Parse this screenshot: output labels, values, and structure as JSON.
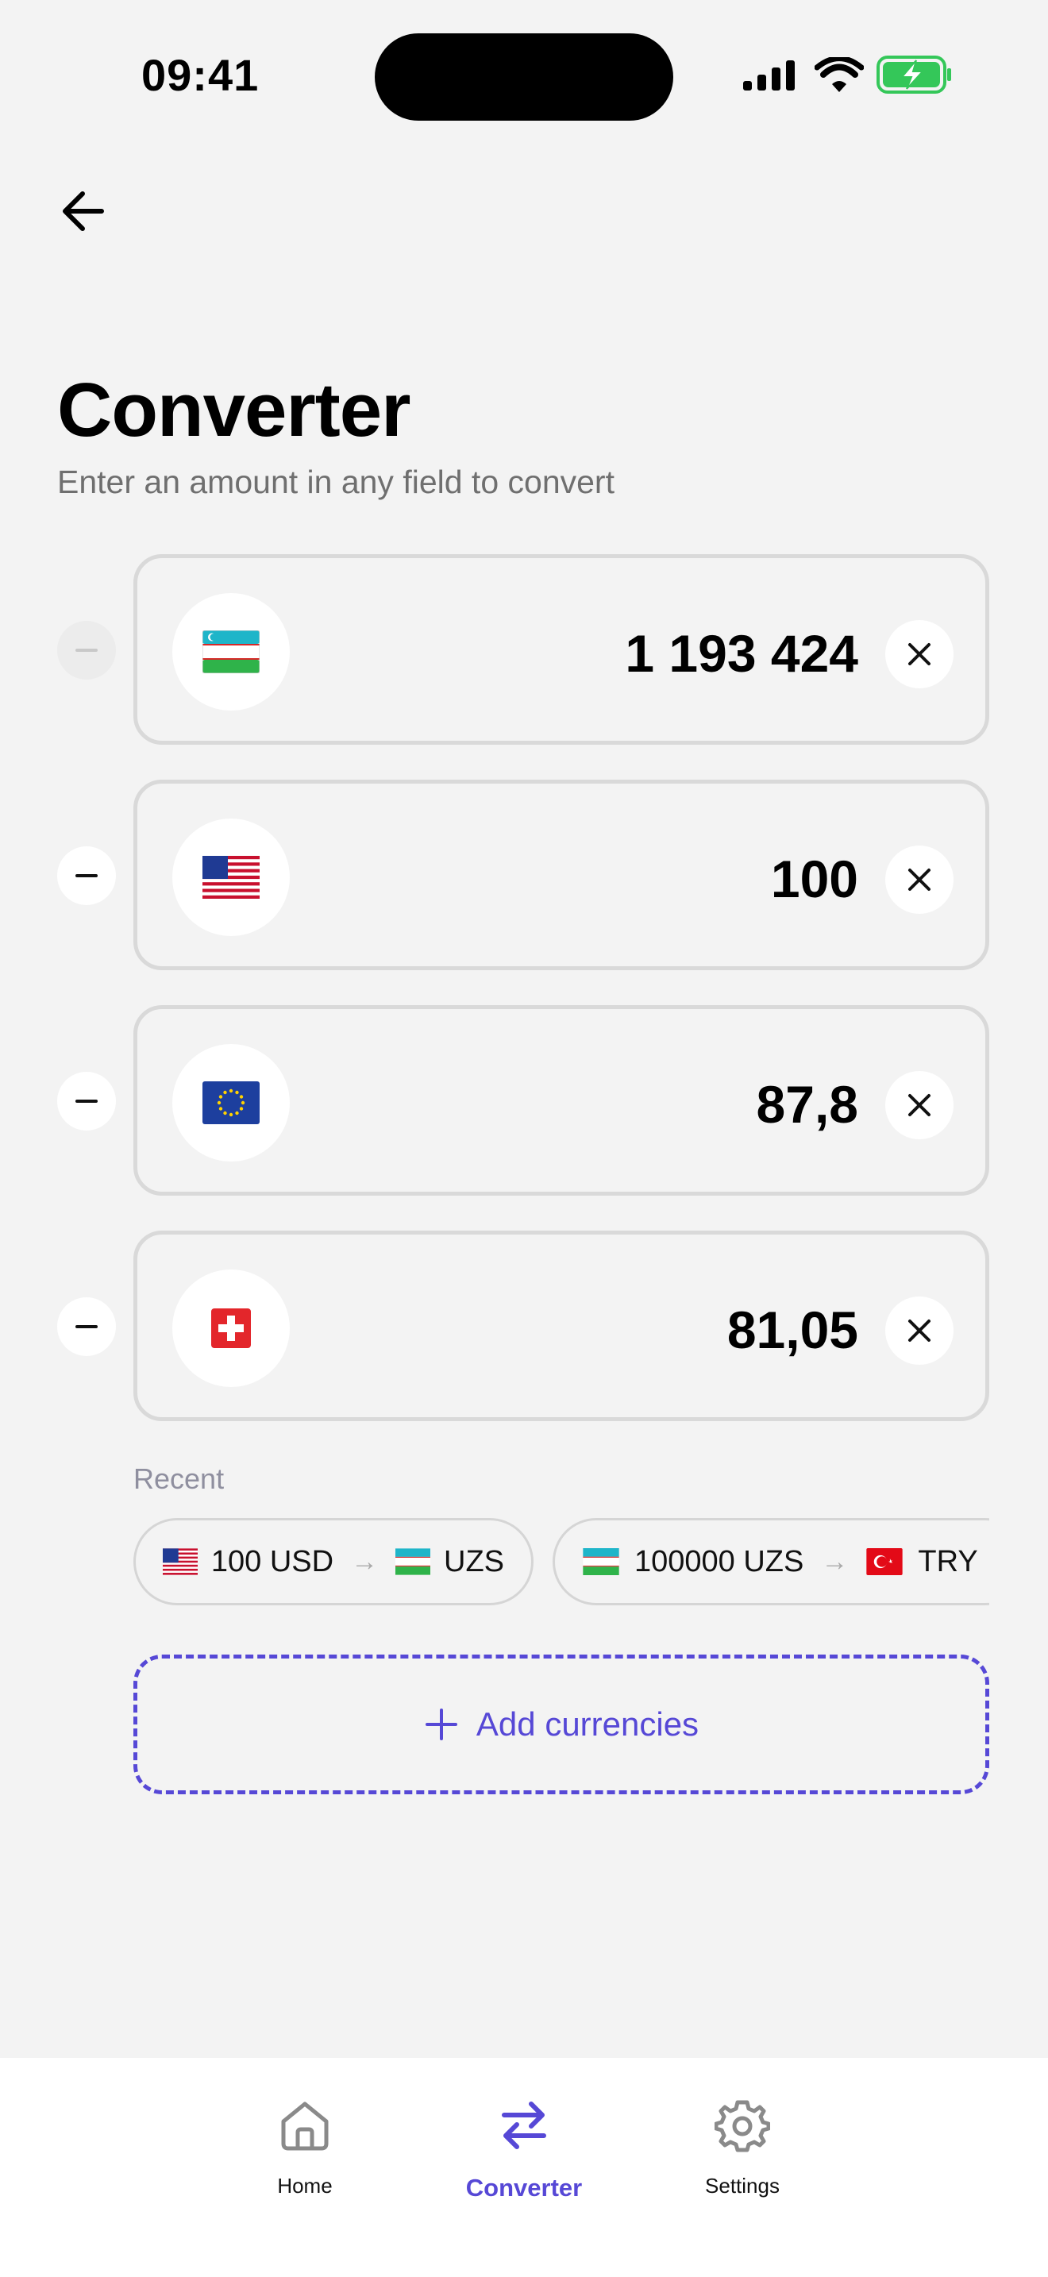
{
  "status_bar": {
    "time": "09:41"
  },
  "header": {
    "title": "Converter",
    "subtitle": "Enter an amount in any field to convert"
  },
  "currencies": [
    {
      "flag": "🇺🇿",
      "code": "UZS",
      "amount": "1 193 424",
      "removable": false
    },
    {
      "flag": "🇺🇸",
      "code": "USD",
      "amount": "100",
      "removable": true
    },
    {
      "flag": "🇪🇺",
      "code": "EUR",
      "amount": "87,8",
      "removable": true
    },
    {
      "flag": "🇨🇭",
      "code": "CHF",
      "amount": "81,05",
      "removable": true
    }
  ],
  "recent": {
    "label": "Recent",
    "items": [
      {
        "from_flag": "🇺🇸",
        "from_text": "100 USD",
        "to_flag": "🇺🇿",
        "to_text": "UZS"
      },
      {
        "from_flag": "🇺🇿",
        "from_text": "100000 UZS",
        "to_flag": "🇹🇷",
        "to_text": "TRY"
      }
    ]
  },
  "add_button": {
    "label": "Add currencies"
  },
  "tabbar": {
    "items": [
      {
        "label": "Home",
        "icon": "home-icon",
        "active": false
      },
      {
        "label": "Converter",
        "icon": "swap-arrows-icon",
        "active": true
      },
      {
        "label": "Settings",
        "icon": "gear-icon",
        "active": false
      }
    ]
  },
  "colors": {
    "accent": "#5648d6",
    "background": "#f3f3f3",
    "battery": "#34c759"
  }
}
